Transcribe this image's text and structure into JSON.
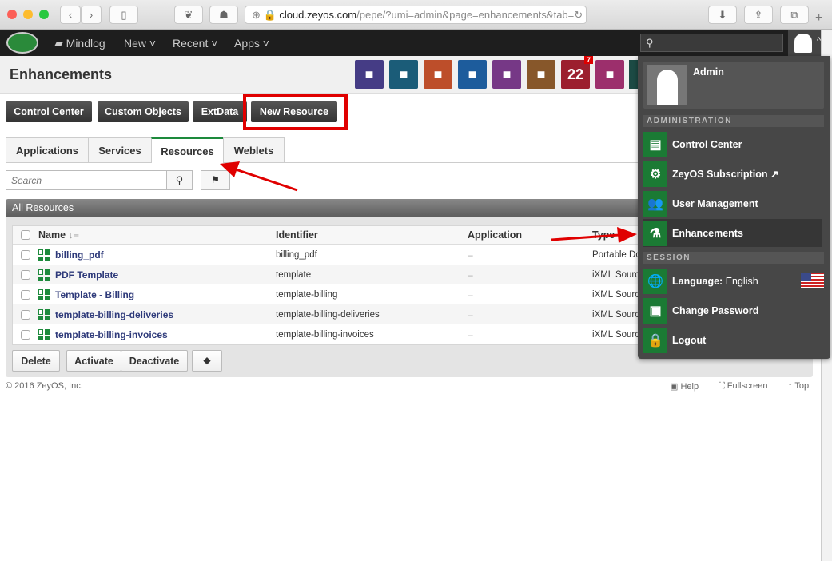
{
  "browser": {
    "url_domain": "cloud.zeyos.com",
    "url_path": "/pepe/?umi=admin&page=enhancements&tab="
  },
  "nav": {
    "items": [
      "Mindlog",
      "New",
      "Recent",
      "Apps"
    ],
    "search_placeholder": ""
  },
  "header": {
    "title": "Enhancements",
    "tiles": [
      {
        "icon": "dollar-icon",
        "color": "#453c85"
      },
      {
        "icon": "truck-icon",
        "color": "#1b5c78"
      },
      {
        "icon": "folder-check-icon",
        "color": "#bd4e2a"
      },
      {
        "icon": "piggy-bank-icon",
        "color": "#1d5c9c"
      },
      {
        "icon": "certificate-icon",
        "color": "#763886"
      },
      {
        "icon": "contacts-icon",
        "color": "#87572a"
      },
      {
        "icon": "calendar-icon",
        "color": "#9c1f2e",
        "text": "22",
        "badge": "7"
      },
      {
        "icon": "cashier-icon",
        "color": "#9c2f6c"
      }
    ]
  },
  "toolbar": {
    "buttons": [
      "Control Center",
      "Custom Objects",
      "ExtData",
      "New Resource"
    ]
  },
  "tabs": [
    {
      "label": "Applications"
    },
    {
      "label": "Services"
    },
    {
      "label": "Resources",
      "active": true
    },
    {
      "label": "Weblets"
    }
  ],
  "search": {
    "placeholder": "Search"
  },
  "panel": {
    "title": "All Resources",
    "columns": [
      "Name",
      "Identifier",
      "Application",
      "Type"
    ],
    "rows": [
      {
        "name": "billing_pdf",
        "identifier": "billing_pdf",
        "application": "–",
        "type": "Portable Do"
      },
      {
        "name": "PDF Template",
        "identifier": "template",
        "application": "–",
        "type": "iXML Source"
      },
      {
        "name": "Template - Billing",
        "identifier": "template-billing",
        "application": "–",
        "type": "iXML Source"
      },
      {
        "name": "template-billing-deliveries",
        "identifier": "template-billing-deliveries",
        "application": "–",
        "type": "iXML Source"
      },
      {
        "name": "template-billing-invoices",
        "identifier": "template-billing-invoices",
        "application": "–",
        "type": "iXML Source"
      }
    ],
    "actions": [
      "Delete",
      "Activate",
      "Deactivate"
    ]
  },
  "footer": {
    "copyright": "© 2016 ZeyOS, Inc.",
    "links": [
      "Help",
      "Fullscreen",
      "Top"
    ]
  },
  "user_menu": {
    "user": "Admin",
    "admin_section": "ADMINISTRATION",
    "admin_items": [
      "Control Center",
      "ZeyOS Subscription",
      "User Management",
      "Enhancements"
    ],
    "session_section": "SESSION",
    "language_label": "Language:",
    "language_value": "English",
    "session_items": [
      "Change Password",
      "Logout"
    ]
  },
  "colors": {
    "accent": "#1d8a3c",
    "annotation": "#e00000"
  }
}
